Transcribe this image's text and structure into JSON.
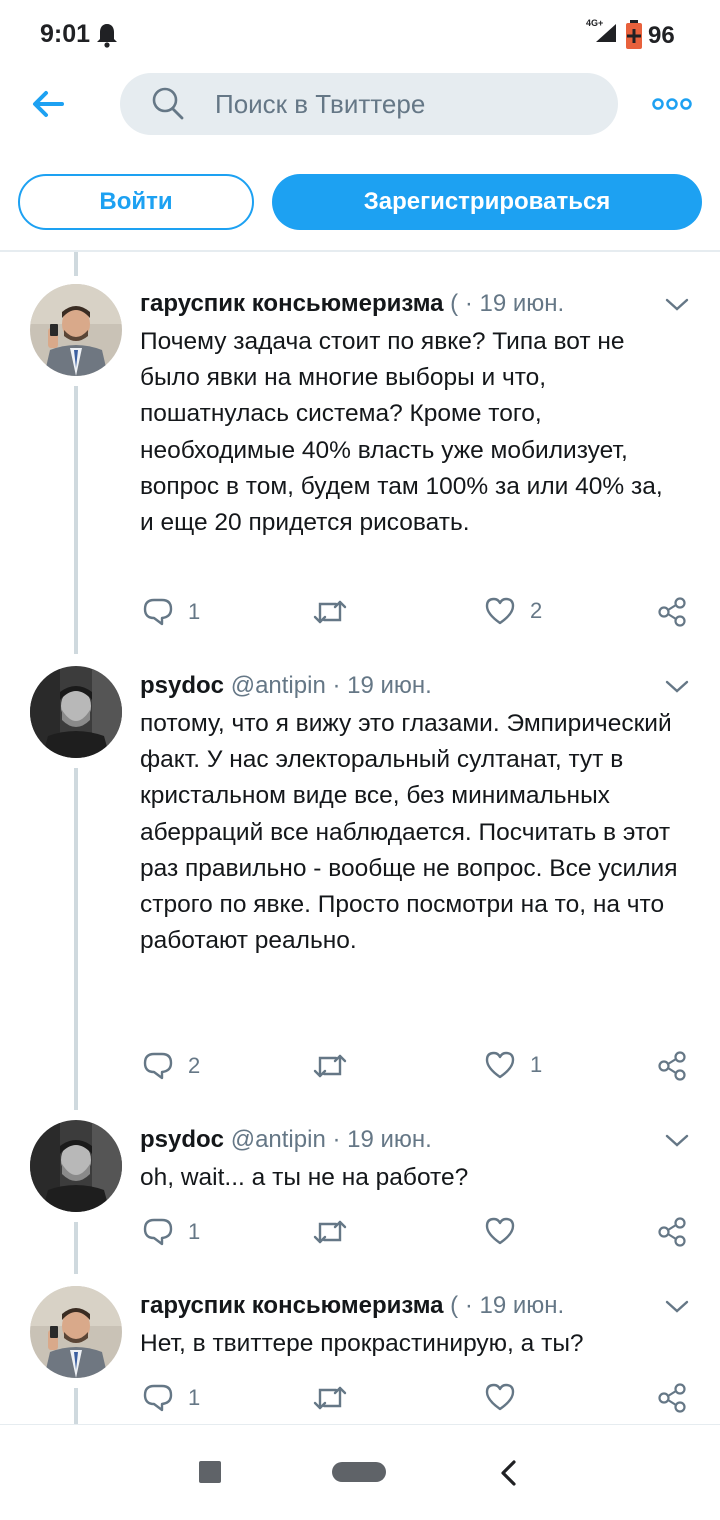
{
  "status_bar": {
    "time": "9:01",
    "network": "4G+",
    "battery": "96"
  },
  "header": {
    "search_placeholder": "Поиск в Твиттере"
  },
  "auth": {
    "login_label": "Войти",
    "signup_label": "Зарегистрироваться"
  },
  "tweets": [
    {
      "name": "гаруспик консьюмеризма",
      "handle": "(",
      "date": "19 июн.",
      "text": "Почему задача стоит по явке? Типа вот не было явки на многие выборы и что, пошатнулась система? Кроме того, необходимые 40% власть уже мобилизует, вопрос в том, будем там 100% за или 40% за, и еще 20 придется рисовать.",
      "replies": "1",
      "retweets": "",
      "likes": "2"
    },
    {
      "name": "psydoc",
      "handle": "@antipin",
      "date": "19 июн.",
      "text": "потому, что я вижу это глазами. Эмпирический факт. У нас электоральный султанат, тут в кристальном виде все, без минимальных аберраций все наблюдается. Посчитать в этот раз правильно - вообще не вопрос. Все усилия строго по явке. Просто посмотри на то, на что работают реально.",
      "replies": "2",
      "retweets": "",
      "likes": "1"
    },
    {
      "name": "psydoc",
      "handle": "@antipin",
      "date": "19 июн.",
      "text": "oh, wait... а ты не на работе?",
      "replies": "1",
      "retweets": "",
      "likes": ""
    },
    {
      "name": "гаруспик консьюмеризма",
      "handle": "(",
      "date": "19 июн.",
      "text": "Нет, в твиттере прокрастинирую, а ты?",
      "replies": "1",
      "retweets": "",
      "likes": ""
    }
  ],
  "colors": {
    "accent": "#1da1f2",
    "secondary_text": "#657786",
    "search_bg": "#e6ecf0"
  }
}
